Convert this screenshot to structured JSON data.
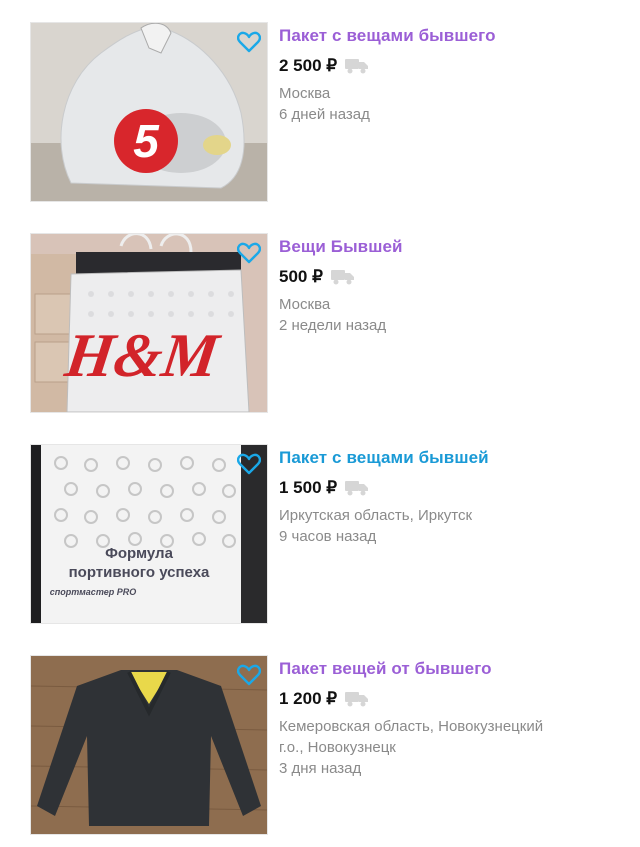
{
  "listings": [
    {
      "title": "Пакет с вещами бывшего",
      "price": "2 500 ₽",
      "location": "Москва",
      "time": "6 дней назад",
      "visited": true
    },
    {
      "title": "Вещи Бывшей",
      "price": "500 ₽",
      "location": "Москва",
      "time": "2 недели назад",
      "visited": true
    },
    {
      "title": "Пакет с вещами бывшей",
      "price": "1 500 ₽",
      "location": "Иркутская область, Иркутск",
      "time": "9 часов назад",
      "visited": false
    },
    {
      "title": "Пакет вещей от бывшего",
      "price": "1 200 ₽",
      "location": "Кемеровская область, Новокузнецкий г.о., Новокузнецк",
      "time": "3 дня назад",
      "visited": true
    }
  ],
  "images": {
    "bag1_logo": "5",
    "bag2_logo": "H&M",
    "bag3_text": [
      "Формула",
      "портивного успеха"
    ],
    "bag3_brand": "спортмастер PRO"
  },
  "icons": {
    "favorite": "heart-outline-icon",
    "delivery": "truck-icon"
  },
  "colors": {
    "visited_link": "#9b5fd6",
    "fresh_link": "#1a9ad6",
    "meta_text": "#8a8a8a",
    "favorite": "#1aa8e8"
  }
}
